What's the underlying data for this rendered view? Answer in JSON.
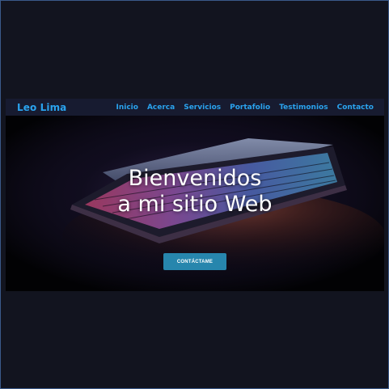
{
  "nav": {
    "brand": "Leo Lima",
    "links": [
      {
        "label": "Inicio"
      },
      {
        "label": "Acerca"
      },
      {
        "label": "Servicios"
      },
      {
        "label": "Portafolio"
      },
      {
        "label": "Testimonios"
      },
      {
        "label": "Contacto"
      }
    ]
  },
  "hero": {
    "title_line1": "Bienvenidos",
    "title_line2": "a mi sitio Web",
    "cta_label": "CONTÁCTAME",
    "image": "laptop-keyboard-backlit-photo"
  },
  "colors": {
    "page_bg": "#12141f",
    "nav_bg": "#171b30",
    "accent": "#2aa3ee",
    "button": "#2786ad",
    "hero_text": "#ffffff"
  }
}
